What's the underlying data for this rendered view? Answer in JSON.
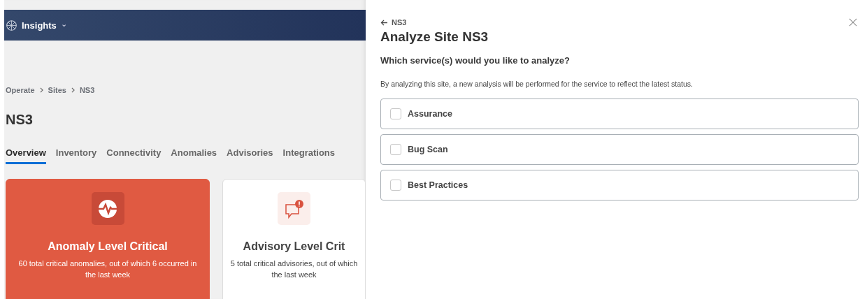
{
  "header": {
    "app_name": "Insights",
    "caret": "⌄"
  },
  "breadcrumbs": [
    "Operate",
    "Sites",
    "NS3"
  ],
  "page_title": "NS3",
  "tabs": [
    {
      "label": "Overview",
      "selected": true
    },
    {
      "label": "Inventory",
      "selected": false
    },
    {
      "label": "Connectivity",
      "selected": false
    },
    {
      "label": "Anomalies",
      "selected": false
    },
    {
      "label": "Advisories",
      "selected": false
    },
    {
      "label": "Integrations",
      "selected": false
    }
  ],
  "cards": [
    {
      "kind": "anomaly",
      "title": "Anomaly Level Critical",
      "description": "60 total critical anomalies, out of which 6 occurred in the last week",
      "highlighted": true
    },
    {
      "kind": "advisory",
      "title": "Advisory Level Crit",
      "description": "5 total critical advisories, out of which the last week",
      "highlighted": false
    }
  ],
  "drawer": {
    "back_label": "NS3",
    "title": "Analyze Site NS3",
    "question": "Which service(s) would you like to analyze?",
    "description": "By analyzing this site, a new analysis will be performed for the service to reflect the latest status.",
    "options": [
      {
        "label": "Assurance",
        "checked": false
      },
      {
        "label": "Bug Scan",
        "checked": false
      },
      {
        "label": "Best Practices",
        "checked": false
      }
    ]
  }
}
